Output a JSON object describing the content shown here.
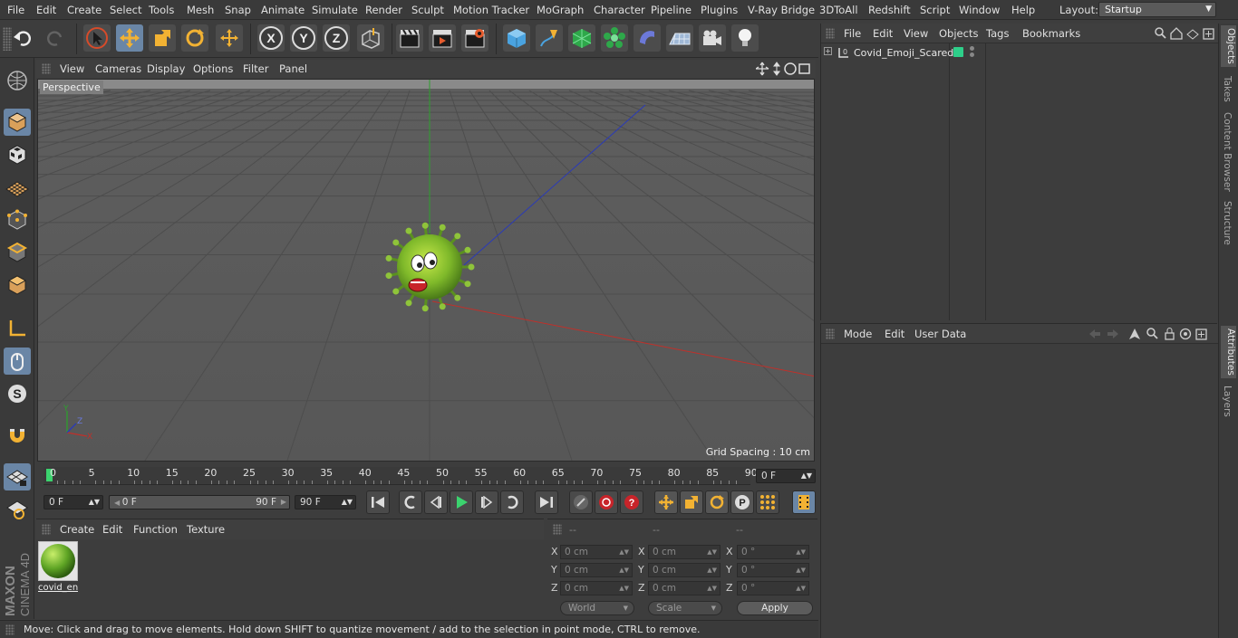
{
  "menu": [
    "File",
    "Edit",
    "Create",
    "Select",
    "Tools",
    "Mesh",
    "Snap",
    "Animate",
    "Simulate",
    "Render",
    "Sculpt",
    "Motion Tracker",
    "MoGraph",
    "Character",
    "Pipeline",
    "Plugins",
    "V-Ray Bridge",
    "3DToAll",
    "Redshift",
    "Script",
    "Window",
    "Help"
  ],
  "layout": {
    "label": "Layout:",
    "value": "Startup"
  },
  "axis_buttons": {
    "x": "X",
    "y": "Y",
    "z": "Z"
  },
  "viewport": {
    "menu": [
      "View",
      "Cameras",
      "Display",
      "Options",
      "Filter",
      "Panel"
    ],
    "label": "Perspective",
    "grid_spacing": "Grid Spacing : 10 cm",
    "axis_x": "X",
    "axis_y": "Y",
    "axis_z": "Z"
  },
  "timeline": {
    "ticks": [
      "0",
      "5",
      "10",
      "15",
      "20",
      "25",
      "30",
      "35",
      "40",
      "45",
      "50",
      "55",
      "60",
      "65",
      "70",
      "75",
      "80",
      "85",
      "90"
    ],
    "current_frame": "0 F",
    "start_field": "0 F",
    "range_start": "0 F",
    "range_end": "90 F",
    "end_field": "90 F"
  },
  "material_manager": {
    "menu": [
      "Create",
      "Edit",
      "Function",
      "Texture"
    ],
    "material_name": "covid_en"
  },
  "coordinates": {
    "headers": [
      "--",
      "--",
      "--"
    ],
    "rows": [
      {
        "axis": "X",
        "pos": "0 cm",
        "size_axis": "X",
        "size": "0 cm",
        "rot_axis": "X",
        "rot": "0 °"
      },
      {
        "axis": "Y",
        "pos": "0 cm",
        "size_axis": "Y",
        "size": "0 cm",
        "rot_axis": "Y",
        "rot": "0 °"
      },
      {
        "axis": "Z",
        "pos": "0 cm",
        "size_axis": "Z",
        "size": "0 cm",
        "rot_axis": "Z",
        "rot": "0 °"
      }
    ],
    "world_label": "World",
    "scale_label": "Scale",
    "apply_label": "Apply"
  },
  "status_text": "Move: Click and drag to move elements. Hold down SHIFT to quantize movement / add to the selection in point mode, CTRL to remove.",
  "object_manager": {
    "menu": [
      "File",
      "Edit",
      "View",
      "Objects",
      "Tags",
      "Bookmarks"
    ],
    "object_name": "Covid_Emoji_Scared",
    "layer_color": "#2ecf8a"
  },
  "attribute_manager": {
    "menu": [
      "Mode",
      "Edit",
      "User Data"
    ]
  },
  "right_tabs": [
    "Objects",
    "Takes",
    "Content Browser",
    "Structure",
    "Attributes",
    "Layers"
  ],
  "brand": {
    "line1": "MAXON",
    "line2": "CINEMA 4D"
  },
  "colors": {
    "accent": "#6a86a6",
    "x_axis": "#c0302a",
    "y_axis": "#2ea02e",
    "z_axis": "#2a3ab8"
  }
}
